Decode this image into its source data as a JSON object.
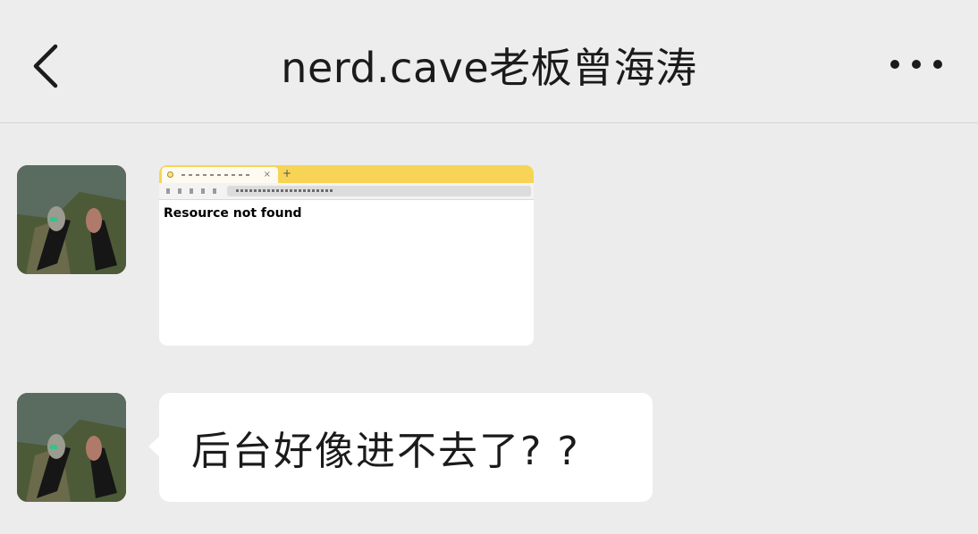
{
  "header": {
    "title": "nerd.cave老板曾海涛",
    "back_icon": "chevron-left-icon",
    "more_icon": "ellipsis-icon"
  },
  "messages": [
    {
      "type": "image",
      "screenshot_text": "Resource not found",
      "tab_color": "#f7d455"
    },
    {
      "type": "text",
      "text": "后台好像进不去了? ?"
    }
  ],
  "colors": {
    "background": "#ececec",
    "bubble": "#ffffff",
    "text": "#1b1b1b"
  }
}
